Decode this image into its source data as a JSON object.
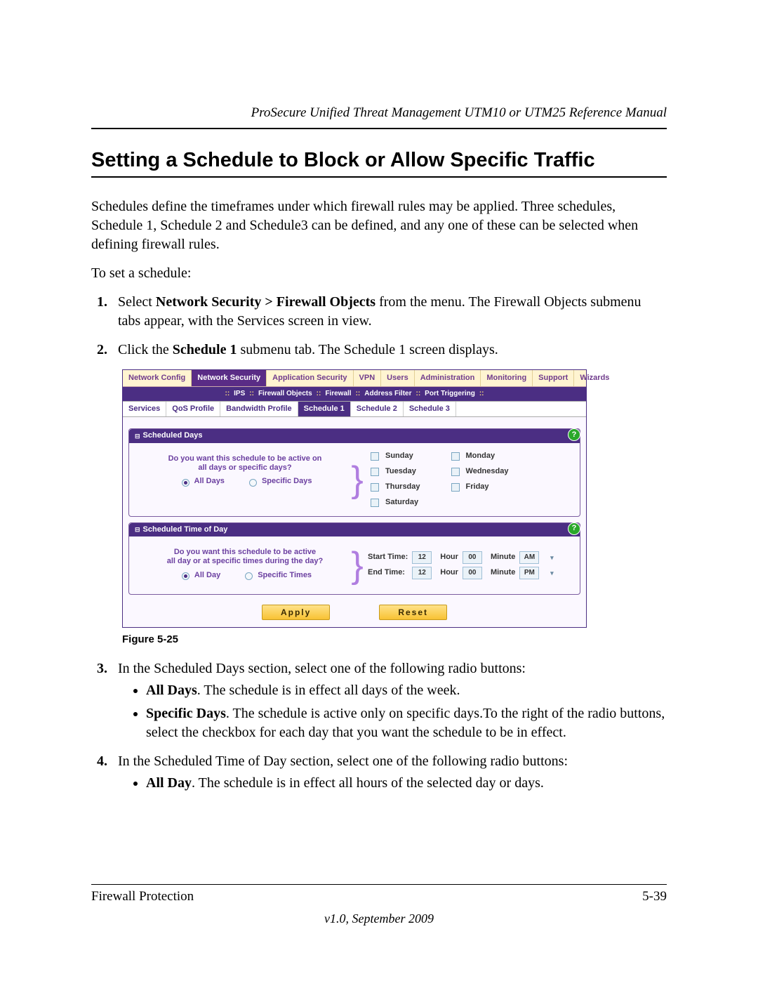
{
  "header": {
    "running": "ProSecure Unified Threat Management UTM10 or UTM25 Reference Manual"
  },
  "title": "Setting a Schedule to Block or Allow Specific Traffic",
  "para": {
    "intro": "Schedules define the timeframes under which firewall rules may be applied. Three schedules, Schedule 1, Schedule 2 and Schedule3 can be defined, and any one of these can be selected when defining firewall rules.",
    "toset": "To set a schedule:"
  },
  "steps": {
    "s1a": "Select ",
    "s1b": "Network Security > Firewall Objects",
    "s1c": " from the menu. The Firewall Objects submenu tabs appear, with the Services screen in view.",
    "s2a": "Click the ",
    "s2b": "Schedule 1",
    "s2c": " submenu tab. The Schedule 1 screen displays.",
    "s3": "In the Scheduled Days section, select one of the following radio buttons:",
    "s3_b1a": "All Days",
    "s3_b1b": ". The schedule is in effect all days of the week.",
    "s3_b2a": "Specific Days",
    "s3_b2b": ". The schedule is active only on specific days.To the right of the radio buttons, select the checkbox for each day that you want the schedule to be in effect.",
    "s4": "In the Scheduled Time of Day section, select one of the following radio buttons:",
    "s4_b1a": "All Day",
    "s4_b1b": ". The schedule is in effect all hours of the selected day or days."
  },
  "figure_caption": "Figure 5-25",
  "shot": {
    "mainnav": [
      "Network Config",
      "Network Security",
      "Application Security",
      "VPN",
      "Users",
      "Administration",
      "Monitoring",
      "Support",
      "Wizards"
    ],
    "mainnav_active": 1,
    "subnav": [
      "IPS",
      "Firewall Objects",
      "Firewall",
      "Address Filter",
      "Port Triggering"
    ],
    "tertiary": [
      "Services",
      "QoS Profile",
      "Bandwidth Profile",
      "Schedule 1",
      "Schedule 2",
      "Schedule 3"
    ],
    "tertiary_active": 3,
    "panel_days": {
      "title": "Scheduled Days",
      "question_l1": "Do you want this schedule to be active on",
      "question_l2": "all days or specific days?",
      "radio_all": "All Days",
      "radio_spec": "Specific Days",
      "days_col1": [
        "Sunday",
        "Tuesday",
        "Thursday",
        "Saturday"
      ],
      "days_col2": [
        "Monday",
        "Wednesday",
        "Friday"
      ]
    },
    "panel_time": {
      "title": "Scheduled Time of Day",
      "question_l1": "Do you want this schedule to be active",
      "question_l2": "all day or at specific times during the day?",
      "radio_all": "All Day",
      "radio_spec": "Specific Times",
      "start_label": "Start Time:",
      "end_label": "End Time:",
      "hour_label": "Hour",
      "minute_label": "Minute",
      "start_hour": "12",
      "start_min": "00",
      "start_ampm": "AM",
      "end_hour": "12",
      "end_min": "00",
      "end_ampm": "PM"
    },
    "buttons": {
      "apply": "Apply",
      "reset": "Reset"
    },
    "help": "?"
  },
  "footer": {
    "left": "Firewall Protection",
    "right": "5-39",
    "version": "v1.0, September 2009"
  }
}
